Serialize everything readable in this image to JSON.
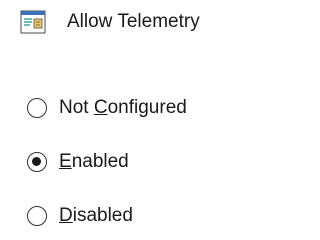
{
  "header": {
    "title": "Allow Telemetry",
    "icon": "policy-setting-icon"
  },
  "options": [
    {
      "label_before": "Not ",
      "label_access": "C",
      "label_after": "onfigured",
      "checked": false
    },
    {
      "label_before": "",
      "label_access": "E",
      "label_after": "nabled",
      "checked": true
    },
    {
      "label_before": "",
      "label_access": "D",
      "label_after": "isabled",
      "checked": false
    }
  ],
  "colors": {
    "icon_blue": "#3b6fb6",
    "icon_teal": "#3aa6a6",
    "text": "#1a1a1a"
  }
}
